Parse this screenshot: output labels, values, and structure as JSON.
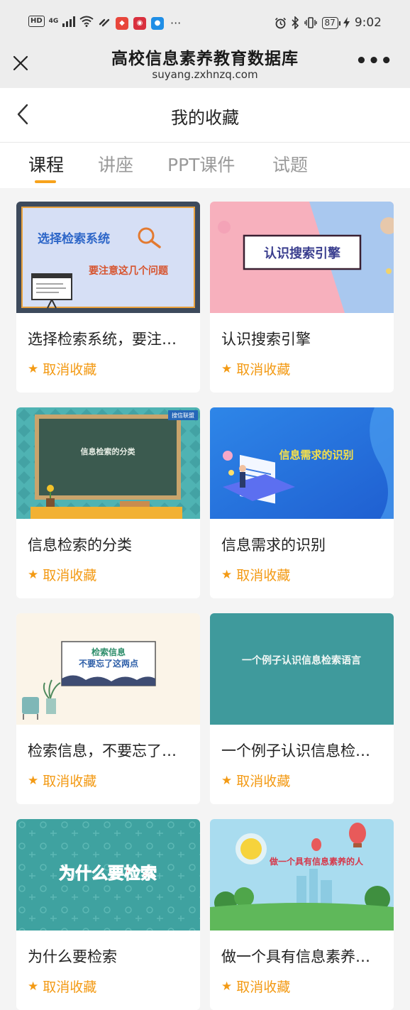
{
  "status_bar": {
    "hd": "HD",
    "network": "4G",
    "battery": "87",
    "time": "9:02",
    "more": "···"
  },
  "browser": {
    "title": "高校信息素养教育数据库",
    "url": "suyang.zxhnzq.com",
    "more": "•••"
  },
  "page": {
    "title": "我的收藏"
  },
  "tabs": [
    {
      "label": "课程",
      "active": true
    },
    {
      "label": "讲座",
      "active": false
    },
    {
      "label": "PPT课件",
      "active": false
    },
    {
      "label": "试题",
      "active": false
    }
  ],
  "cards": [
    {
      "title": "选择检索系统，要注意这几个问题",
      "fav": "取消收藏",
      "thumb_lines": [
        "选择检索系统",
        "要注意这几个问题"
      ]
    },
    {
      "title": "认识搜索引擎",
      "fav": "取消收藏",
      "thumb_lines": [
        "认识搜索引擎"
      ]
    },
    {
      "title": "信息检索的分类",
      "fav": "取消收藏",
      "thumb_lines": [
        "信息检索的分类"
      ],
      "thumb_logo": "搜信联盟"
    },
    {
      "title": "信息需求的识别",
      "fav": "取消收藏",
      "thumb_lines": [
        "信息需求的识别"
      ]
    },
    {
      "title": "检索信息，不要忘了这两点",
      "fav": "取消收藏",
      "thumb_lines": [
        "检索信息",
        "不要忘了这两点"
      ]
    },
    {
      "title": "一个例子认识信息检索语言",
      "fav": "取消收藏",
      "thumb_lines": [
        "一个例子认识信息检索语言"
      ]
    },
    {
      "title": "为什么要检索",
      "fav": "取消收藏",
      "thumb_lines": [
        "为什么要检索"
      ]
    },
    {
      "title": "做一个具有信息素养的人",
      "fav": "取消收藏",
      "thumb_lines": [
        "做一个具有信息素养的人"
      ]
    }
  ],
  "colors": {
    "accent": "#f7a21b",
    "fav": "#f39a14"
  }
}
